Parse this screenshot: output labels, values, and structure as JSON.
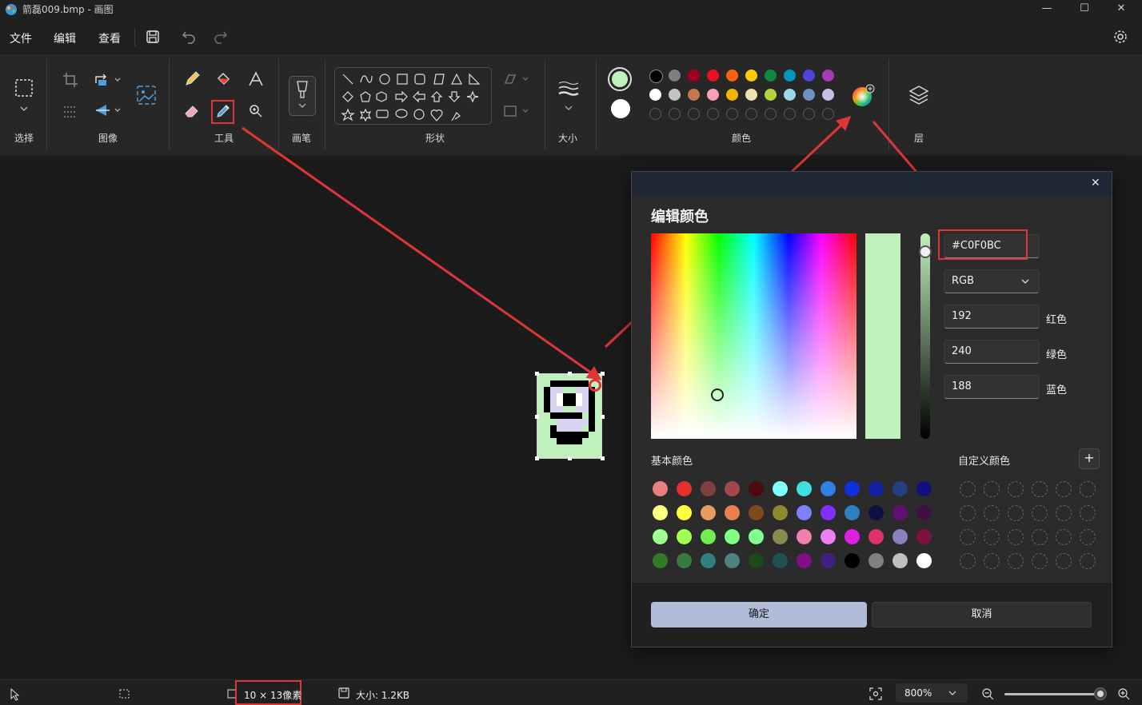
{
  "window": {
    "title": "箭磊009.bmp - 画图",
    "min": "—",
    "max": "☐",
    "close": "✕"
  },
  "menu": {
    "file": "文件",
    "edit": "编辑",
    "view": "查看"
  },
  "ribbon": {
    "select_label": "选择",
    "image_label": "图像",
    "tools_label": "工具",
    "brush_label": "画笔",
    "shapes_label": "形状",
    "size_label": "大小",
    "colors_label": "颜色",
    "layers_label": "层"
  },
  "colors": {
    "primary": "#C0F0BC",
    "secondary": "#FFFFFF",
    "palette_row1": [
      "#000000",
      "#7f7f7f",
      "#a4001d",
      "#e81123",
      "#f7630c",
      "#ffcc00",
      "#10893e",
      "#0099bc",
      "#4f43d9",
      "#a43db1"
    ],
    "palette_row2": [
      "#ffffff",
      "#c3c3c3",
      "#c0794e",
      "#f7a1b9",
      "#f4b400",
      "#efe4b0",
      "#b5d33e",
      "#99d9ea",
      "#7092be",
      "#c8bfe7"
    ]
  },
  "dialog": {
    "title": "编辑颜色",
    "close": "✕",
    "hex_value": "#C0F0BC",
    "mode": "RGB",
    "red_value": "192",
    "red_label": "红色",
    "green_value": "240",
    "green_label": "绿色",
    "blue_value": "188",
    "blue_label": "蓝色",
    "basic_colors_label": "基本颜色",
    "custom_colors_label": "自定义颜色",
    "add_custom": "+",
    "ok": "确定",
    "cancel": "取消",
    "basic_colors": [
      [
        "#e88080",
        "#e52f2f",
        "#7f3f3f",
        "#a04848",
        "#4a0c0c",
        "#80ffff",
        "#40e0e0",
        "#2f80e0",
        "#1030e0",
        "#1020a0",
        "#204080",
        "#101080"
      ],
      [
        "#ffff80",
        "#ffff40",
        "#e89a60",
        "#e88050",
        "#7f4a1a",
        "#8a8a30",
        "#8080ff",
        "#7f30ff",
        "#3080c0",
        "#101040",
        "#601070",
        "#401040"
      ],
      [
        "#a0ff90",
        "#a0ff50",
        "#70ee50",
        "#80ff80",
        "#80ff90",
        "#8a8a50",
        "#f080b0",
        "#f080f0",
        "#e020e0",
        "#e03070",
        "#8a80c0",
        "#801040"
      ],
      [
        "#307a2a",
        "#3a7a40",
        "#308080",
        "#508080",
        "#1a4a1a",
        "#205050",
        "#801080",
        "#402080",
        "#000000",
        "#808080",
        "#c0c0c0",
        "#ffffff"
      ]
    ]
  },
  "status": {
    "dimensions": "10 × 13像素",
    "size": "大小: 1.2KB",
    "zoom": "800%"
  }
}
